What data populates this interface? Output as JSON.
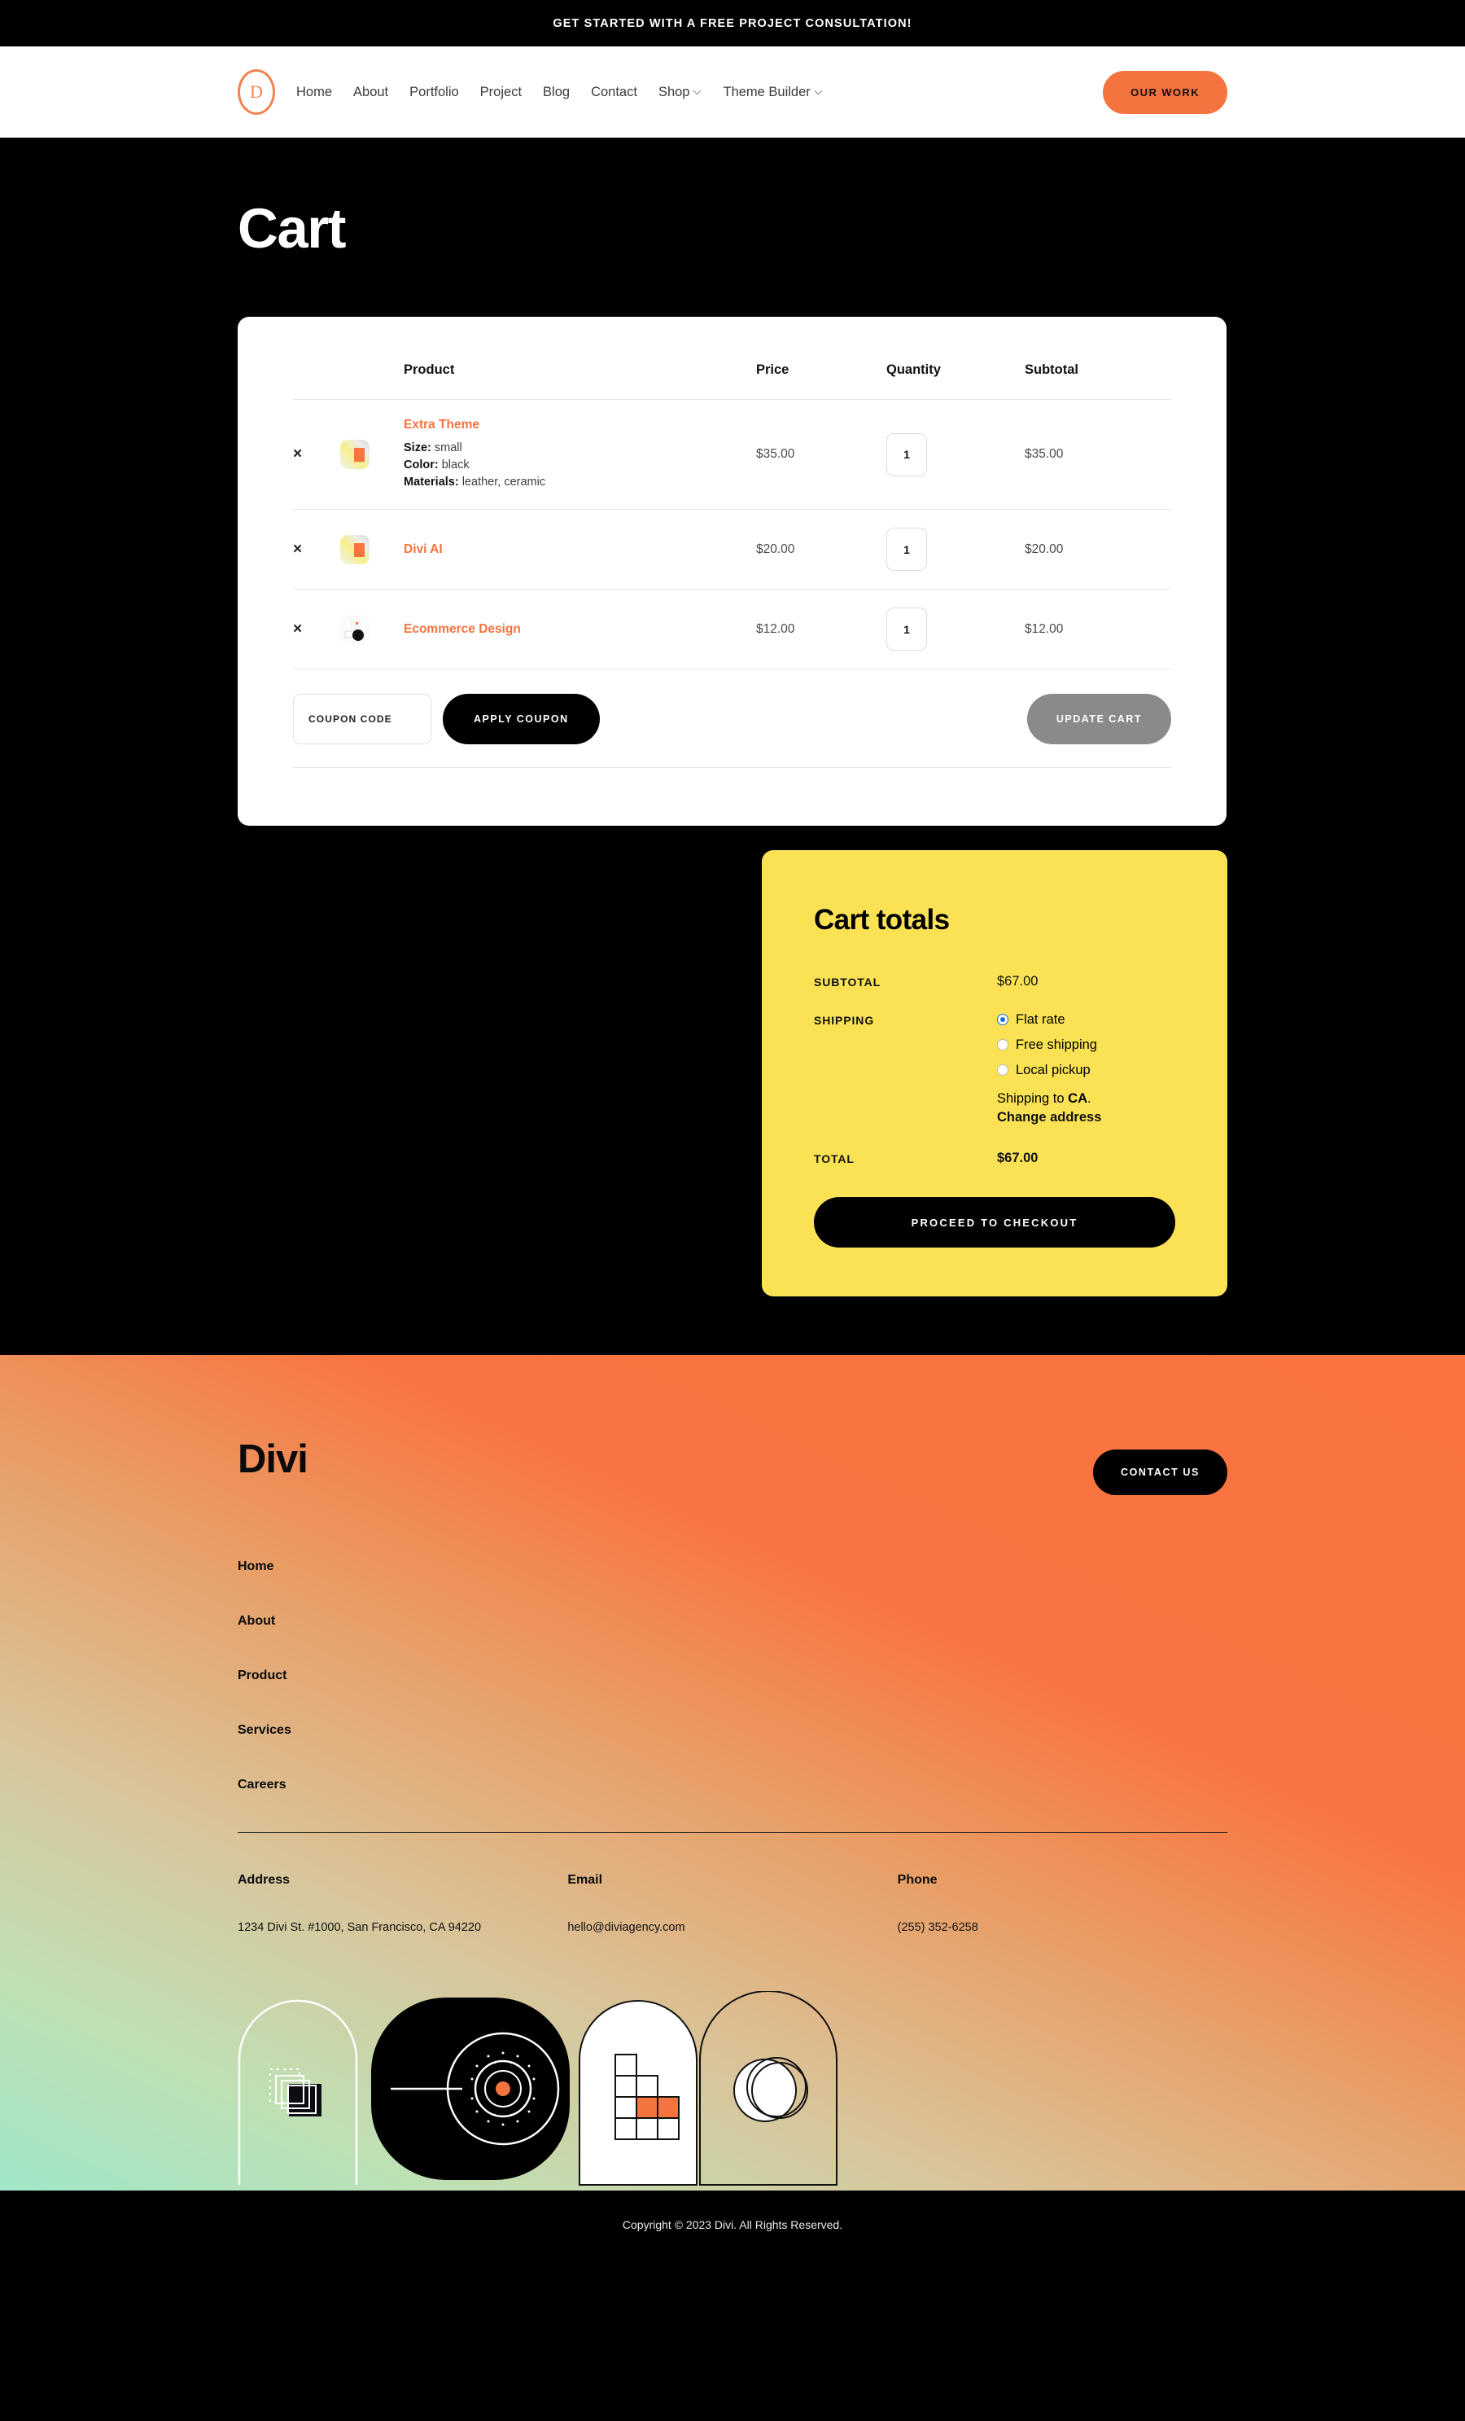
{
  "announcement": {
    "text": "GET STARTED WITH A FREE PROJECT CONSULTATION!"
  },
  "header": {
    "logo_letter": "D",
    "nav": [
      {
        "label": "Home",
        "has_caret": false
      },
      {
        "label": "About",
        "has_caret": false
      },
      {
        "label": "Portfolio",
        "has_caret": false
      },
      {
        "label": "Project",
        "has_caret": false
      },
      {
        "label": "Blog",
        "has_caret": false
      },
      {
        "label": "Contact",
        "has_caret": false
      },
      {
        "label": "Shop",
        "has_caret": true
      },
      {
        "label": "Theme Builder",
        "has_caret": true
      }
    ],
    "cta_label": "OUR WORK"
  },
  "page": {
    "title": "Cart"
  },
  "cart": {
    "columns": {
      "product": "Product",
      "price": "Price",
      "quantity": "Quantity",
      "subtotal": "Subtotal"
    },
    "items": [
      {
        "name": "Extra Theme",
        "price": "$35.00",
        "quantity": "1",
        "subtotal": "$35.00",
        "meta": [
          {
            "key": "Size:",
            "value": " small"
          },
          {
            "key": "Color:",
            "value": " black"
          },
          {
            "key": "Materials:",
            "value": " leather, ceramic"
          }
        ]
      },
      {
        "name": "Divi AI",
        "price": "$20.00",
        "quantity": "1",
        "subtotal": "$20.00",
        "meta": []
      },
      {
        "name": "Ecommerce Design",
        "price": "$12.00",
        "quantity": "1",
        "subtotal": "$12.00",
        "meta": []
      }
    ],
    "coupon_placeholder": "COUPON CODE",
    "coupon_value": "",
    "apply_label": "APPLY COUPON",
    "update_label": "UPDATE CART",
    "remove_icon": "×"
  },
  "totals": {
    "title": "Cart totals",
    "subtotal_label": "SUBTOTAL",
    "subtotal_value": "$67.00",
    "shipping_label": "SHIPPING",
    "shipping_options": [
      {
        "label": "Flat rate",
        "selected": true
      },
      {
        "label": "Free shipping",
        "selected": false
      },
      {
        "label": "Local pickup",
        "selected": false
      }
    ],
    "shipping_to_prefix": "Shipping to ",
    "shipping_to_state": "CA",
    "shipping_to_suffix": ".",
    "change_address_label": "Change address",
    "total_label": "TOTAL",
    "total_value": "$67.00",
    "checkout_label": "PROCEED TO CHECKOUT"
  },
  "footer": {
    "brand": "Divi",
    "contact_label": "CONTACT US",
    "links": [
      "Home",
      "About",
      "Product",
      "Services",
      "Careers"
    ],
    "columns": [
      {
        "heading": "Address",
        "value": "1234 Divi St. #1000, San Francisco, CA 94220"
      },
      {
        "heading": "Email",
        "value": "hello@diviagency.com"
      },
      {
        "heading": "Phone",
        "value": "(255) 352-6258"
      }
    ]
  },
  "copyright": {
    "text": "Copyright © 2023 Divi. All Rights Reserved."
  },
  "colors": {
    "accent_orange": "#F4733F",
    "totals_yellow": "#FAE254",
    "dark": "#000000",
    "radio_blue": "#1a6fd4",
    "update_gray": "#8a8a8a"
  }
}
